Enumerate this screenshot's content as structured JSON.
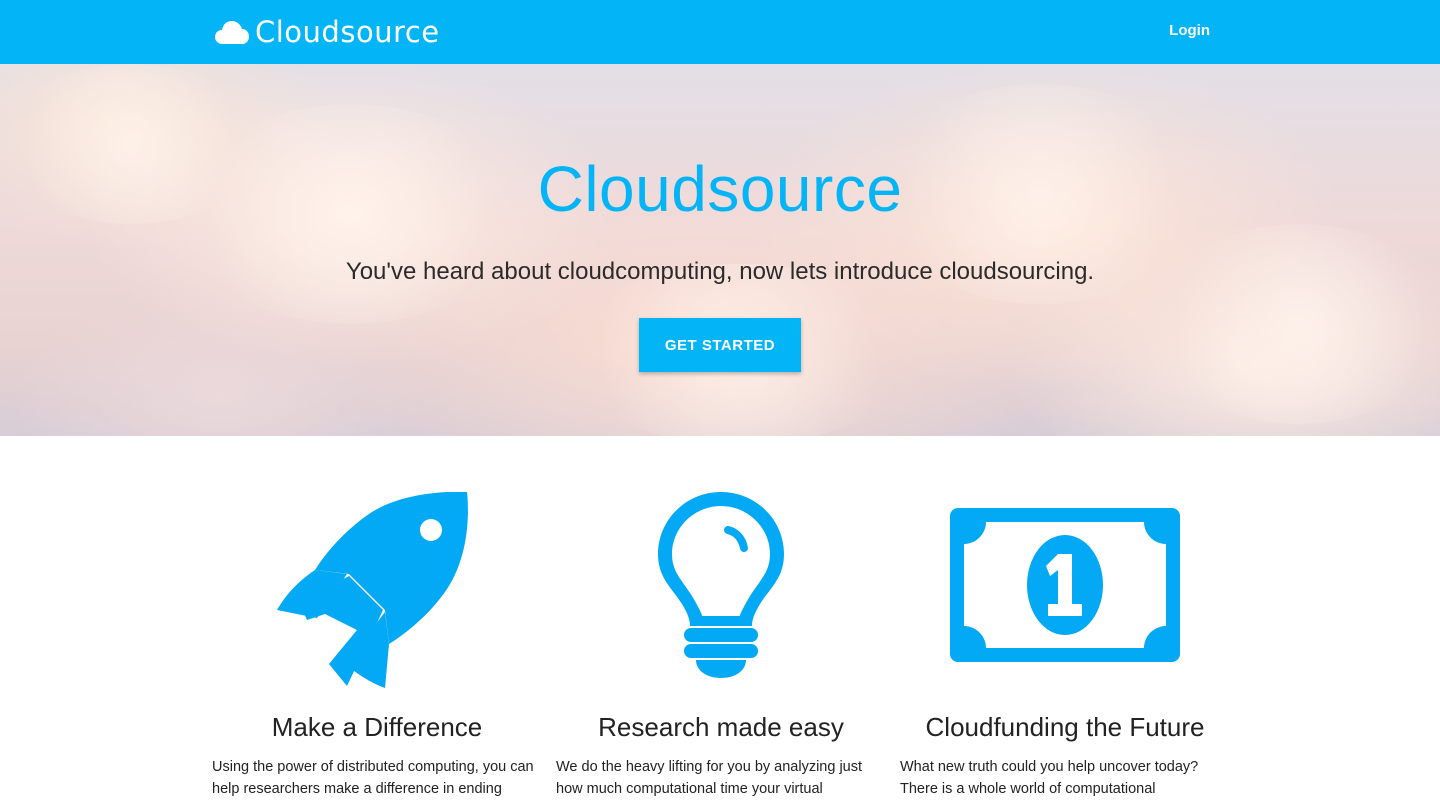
{
  "nav": {
    "brand": "Cloudsource",
    "brand_icon": "cloud-icon",
    "login": "Login",
    "background": "#03b5f7"
  },
  "hero": {
    "title": "Cloudsource",
    "subtitle": "You've heard about cloudcomputing, now lets introduce cloudsourcing.",
    "cta": "GET STARTED"
  },
  "features": [
    {
      "icon": "rocket-icon",
      "title": "Make a Difference",
      "text": "Using the power of distributed computing, you can help researchers make a difference in ending"
    },
    {
      "icon": "lightbulb-icon",
      "title": "Research made easy",
      "text": "We do the heavy lifting for you by analyzing just how much computational time your virtual"
    },
    {
      "icon": "dollar-bill-icon",
      "title": "Cloudfunding the Future",
      "text": "What new truth could you help uncover today? There is a whole world of computational"
    }
  ],
  "colors": {
    "accent": "#03b5f7"
  }
}
